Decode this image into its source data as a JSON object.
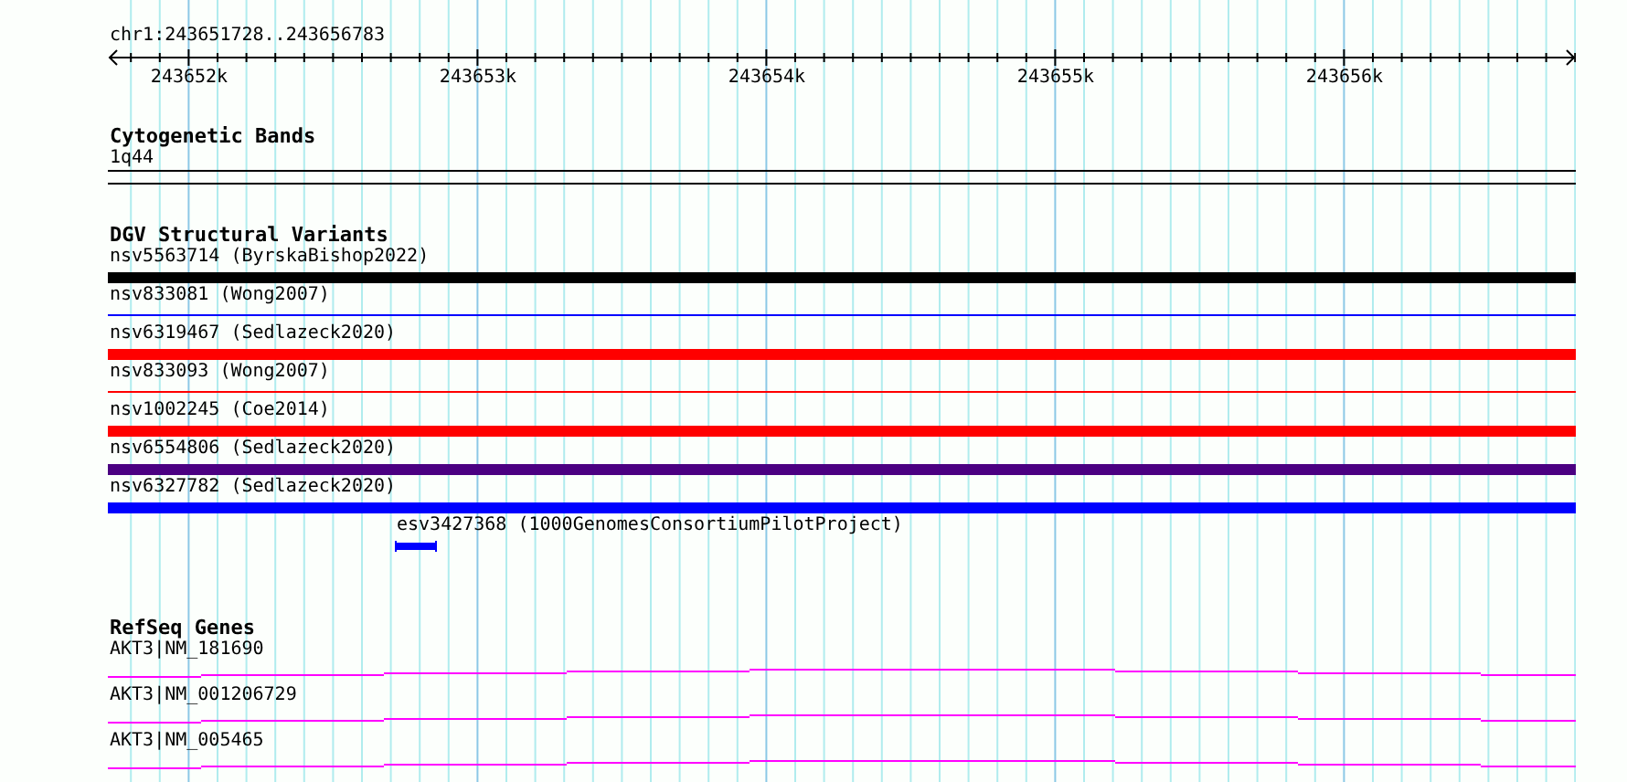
{
  "ruler": {
    "location": "chr1:243651728..243656783",
    "ticks": [
      "243652k",
      "243653k",
      "243654k",
      "243655k",
      "243656k"
    ]
  },
  "cytogenetic_bands": {
    "title": "Cytogenetic Bands",
    "band": "1q44"
  },
  "dgv_structural_variants": {
    "title": "DGV Structural Variants",
    "variants": [
      {
        "label": "nsv5563714 (ByrskaBishop2022)",
        "color": "#000000",
        "kind": "thick"
      },
      {
        "label": "nsv833081 (Wong2007)",
        "color": "#0000ff",
        "kind": "thin"
      },
      {
        "label": "nsv6319467 (Sedlazeck2020)",
        "color": "#ff0000",
        "kind": "thick"
      },
      {
        "label": "nsv833093 (Wong2007)",
        "color": "#ff0000",
        "kind": "thin"
      },
      {
        "label": "nsv1002245 (Coe2014)",
        "color": "#ff0000",
        "kind": "thick"
      },
      {
        "label": "nsv6554806 (Sedlazeck2020)",
        "color": "#4b0082",
        "kind": "thick"
      },
      {
        "label": "nsv6327782 (Sedlazeck2020)",
        "color": "#0000ff",
        "kind": "thick"
      },
      {
        "label": "esv3427368 (1000GenomesConsortiumPilotProject)",
        "color": "#0000ff",
        "kind": "short"
      }
    ]
  },
  "refseq_genes": {
    "title": "RefSeq Genes",
    "genes": [
      {
        "label": "AKT3|NM_181690"
      },
      {
        "label": "AKT3|NM_001206729"
      },
      {
        "label": "AKT3|NM_005465"
      }
    ]
  }
}
